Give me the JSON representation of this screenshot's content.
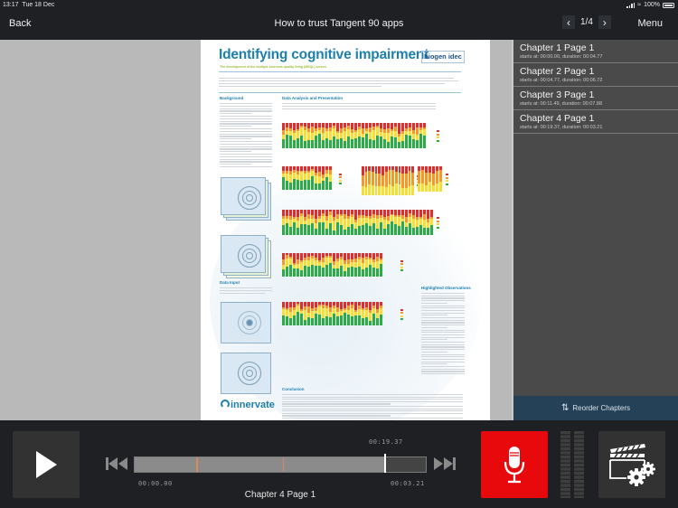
{
  "status_bar": {
    "time": "13:17",
    "date": "Tue 18 Dec",
    "battery": "100%"
  },
  "navbar": {
    "back_label": "Back",
    "title": "How to trust Tangent 90 apps",
    "page_indicator": "1/4",
    "menu_label": "Menu"
  },
  "document": {
    "title": "Identifying cognitive impairment",
    "subtitle": "The development of the multiple sclerosis quality living (MSQL) screen",
    "logo_text": "biogen idec",
    "sections": {
      "background": "Background",
      "data_analysis": "Data Analysis and Presentation",
      "data_input": "Data Input",
      "highlighted": "Highlighted Observations",
      "conclusion": "Conclusion"
    },
    "footer_logo": "innervate"
  },
  "chapters": [
    {
      "title": "Chapter 1 Page 1",
      "meta": "starts at: 00:00.00, duration: 00:04.77"
    },
    {
      "title": "Chapter 2 Page 1",
      "meta": "starts at: 00:04.77, duration: 00:06.72"
    },
    {
      "title": "Chapter 3 Page 1",
      "meta": "starts at: 00:11.49, duration: 00:07.88"
    },
    {
      "title": "Chapter 4 Page 1",
      "meta": "starts at: 00:19.37, duration: 00:03.21"
    }
  ],
  "reorder_label": "Reorder Chapters",
  "player": {
    "start_time": "00:00.00",
    "current_time": "00:19.37",
    "remaining_time": "00:03.21",
    "current_chapter": "Chapter 4 Page 1",
    "total_seconds": 22.58,
    "position_seconds": 19.37,
    "chapter_marker_seconds": [
      4.77,
      11.49
    ]
  },
  "colors": {
    "record_red": "#e8090c",
    "marker_orange": "#d88a5c",
    "reorder_bg": "#254158",
    "doc_title_blue": "#1d7fae"
  }
}
